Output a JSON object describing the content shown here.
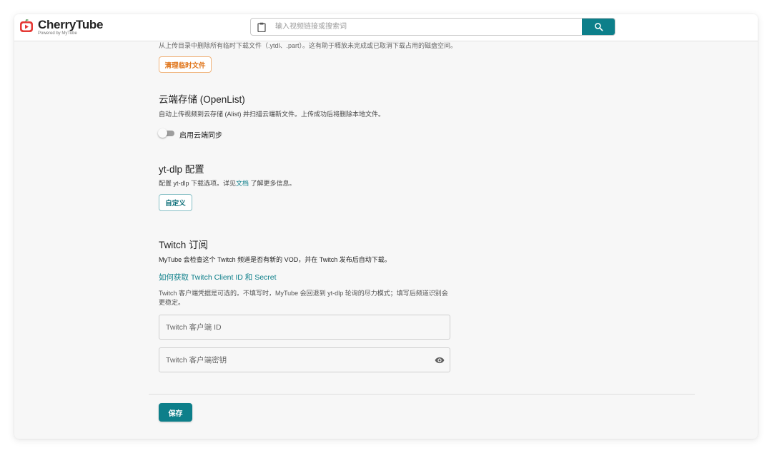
{
  "app": {
    "name": "CherryTube",
    "subtitle": "Powered by MyTube"
  },
  "search": {
    "placeholder": "输入视频链接或搜索词"
  },
  "cleanup": {
    "description": "从上传目录中删除所有临时下载文件（.ytdl、.part）。这有助于释放未完成或已取消下载占用的磁盘空间。",
    "button_label": "清理临时文件"
  },
  "cloud": {
    "title": "云端存储 (OpenList)",
    "description": "自动上传视频到云存储 (Alist) 并扫描云端新文件。上传成功后将删除本地文件。",
    "toggle_label": "启用云端同步",
    "toggle_enabled": false
  },
  "ytdlp": {
    "title": "yt-dlp 配置",
    "description_pre": "配置 yt-dlp 下载选项。详见",
    "description_link": "文档",
    "description_post": "了解更多信息。",
    "button_label": "自定义"
  },
  "twitch": {
    "title": "Twitch 订阅",
    "description": "MyTube 会检查这个 Twitch 频道是否有新的 VOD，并在 Twitch 发布后自动下载。",
    "help_link": "如何获取 Twitch Client ID 和 Secret",
    "note": "Twitch 客户端凭据是可选的。不填写时，MyTube 会回退到 yt-dlp 轮询的尽力模式；填写后频道识别会更稳定。",
    "client_id_placeholder": "Twitch 客户端 ID",
    "client_secret_placeholder": "Twitch 客户端密钥"
  },
  "footer": {
    "save_label": "保存"
  },
  "colors": {
    "accent": "#0d7f8a",
    "warning": "#e0761c",
    "logo_red": "#e53935"
  }
}
